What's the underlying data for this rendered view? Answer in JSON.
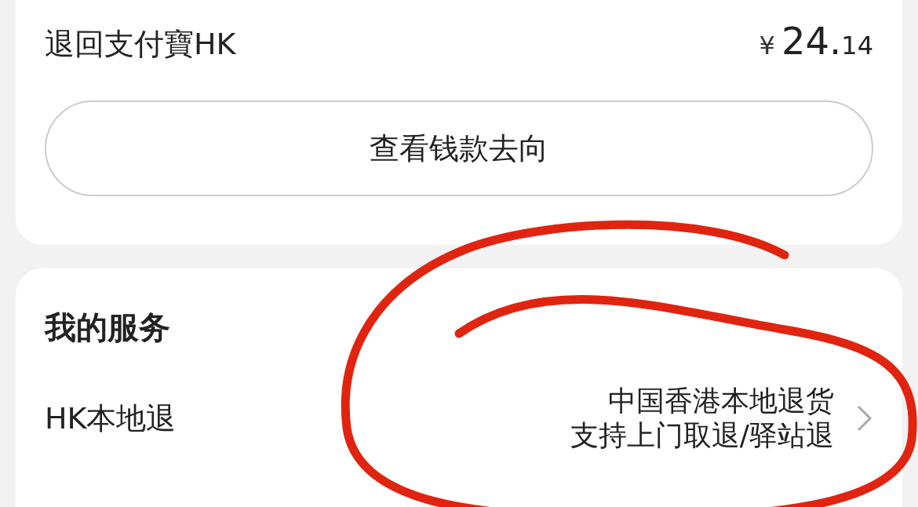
{
  "refund": {
    "label": "退回支付寶HK",
    "currency": "¥",
    "amount_main": "24.",
    "amount_cents": "14",
    "button": "查看钱款去向"
  },
  "services": {
    "title": "我的服务",
    "rows": [
      {
        "label": "HK本地退",
        "lines": [
          "中国香港本地退货",
          "支持上门取退/驿站退"
        ]
      }
    ]
  }
}
